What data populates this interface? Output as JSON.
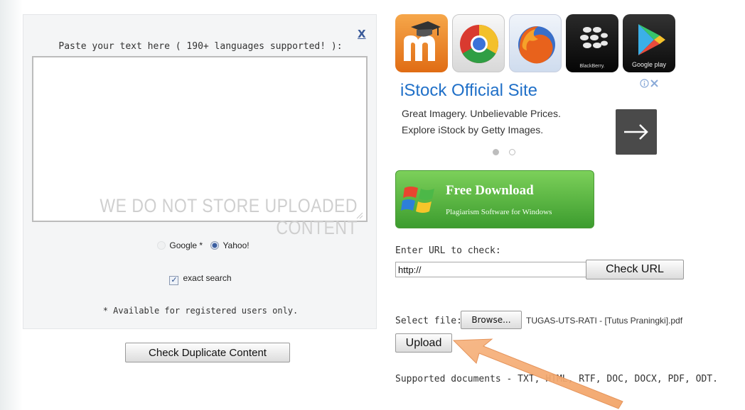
{
  "left_panel": {
    "close_label": "X",
    "paste_label": "Paste your text here ( 190+ languages supported! ):",
    "textarea_value": "",
    "watermark": "WE DO NOT STORE UPLOADED CONTENT",
    "engines": {
      "google_label": "Google *",
      "yahoo_label": "Yahoo!",
      "selected": "Yahoo!"
    },
    "exact_search_label": "exact search",
    "exact_search_checked": true,
    "registered_note": "* Available for registered users only.",
    "check_duplicate_label": "Check Duplicate Content"
  },
  "app_icons": [
    {
      "name": "moodle-icon",
      "caption": ""
    },
    {
      "name": "chrome-icon",
      "caption": ""
    },
    {
      "name": "firefox-icon",
      "caption": ""
    },
    {
      "name": "blackberry-icon",
      "caption": "BlackBerry."
    },
    {
      "name": "google-play-icon",
      "caption": "Google play"
    }
  ],
  "ad": {
    "title": "iStock Official Site",
    "line1": "Great Imagery. Unbelievable Prices.",
    "line2": "Explore iStock by Getty Images.",
    "active_slide": 1,
    "total_slides": 2
  },
  "free_download": {
    "title": "Free Download",
    "subtitle": "Plagiarism Software for Windows"
  },
  "url_check": {
    "label": "Enter URL to check:",
    "value": "http://",
    "button_label": "Check URL"
  },
  "file_upload": {
    "label": "Select file:",
    "browse_label": "Browse...",
    "file_name": "TUGAS-UTS-RATI - [Tutus Praningki].pdf",
    "upload_label": "Upload"
  },
  "supported_docs": "Supported documents - TXT, HTML, RTF, DOC, DOCX, PDF, ODT.",
  "colors": {
    "link_blue": "#2070c8",
    "banner_green": "#4caf3a",
    "annotation_arrow": "#f0a060"
  }
}
